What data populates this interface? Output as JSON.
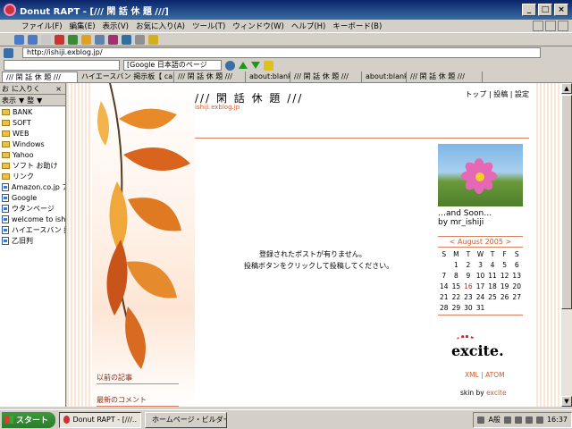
{
  "window": {
    "title": "Donut RAPT - [/// 閑 話 休 題 ///]",
    "minimize": "_",
    "maximize": "□",
    "close": "×"
  },
  "menu": [
    "ファイル(F)",
    "編集(E)",
    "表示(V)",
    "お気に入り(A)",
    "ツール(T)",
    "ウィンドウ(W)",
    "ヘルプ(H)",
    "キーボード(B)"
  ],
  "address": {
    "url": "http://ishiji.exblog.jp/"
  },
  "search": {
    "engine": "[Google 日本語のページ"
  },
  "tabs": [
    {
      "label": "/// 閑 話 休 題 ///",
      "active": true
    },
    {
      "label": "ハイエースバン 掲示板【 ca..",
      "active": false
    },
    {
      "label": "/// 閑 話 休 題 ///",
      "active": false
    },
    {
      "label": "about:blank",
      "active": false
    },
    {
      "label": "/// 閑 話 休 題 ///",
      "active": false
    },
    {
      "label": "about:blank",
      "active": false
    },
    {
      "label": "/// 閑 話 休 題 ///",
      "active": false
    }
  ],
  "sidebar": {
    "tabs": [
      "お",
      "に入りく",
      "×"
    ],
    "tools": [
      "表示",
      "▼",
      "整",
      "▼"
    ],
    "items": [
      {
        "label": "BANK",
        "type": "folder"
      },
      {
        "label": "SOFT",
        "type": "folder"
      },
      {
        "label": "WEB",
        "type": "folder"
      },
      {
        "label": "Windows",
        "type": "folder"
      },
      {
        "label": "Yahoo",
        "type": "folder"
      },
      {
        "label": "ソフト お助け",
        "type": "folder"
      },
      {
        "label": "リンク",
        "type": "folder"
      },
      {
        "label": "Amazon.co.jp ア",
        "type": "page"
      },
      {
        "label": "Google",
        "type": "page"
      },
      {
        "label": "ウタンページ",
        "type": "page"
      },
      {
        "label": "welcome to ish",
        "type": "page"
      },
      {
        "label": "ハイエースバン 掲",
        "type": "page"
      },
      {
        "label": "乙旧判",
        "type": "page"
      }
    ]
  },
  "blog": {
    "title": "/// 閑 話 休 題 ///",
    "url": "ishiji.exblog.jp",
    "nav": "トップ | 投稿 | 設定",
    "notice_line1": "登録されたポストが有りません。",
    "notice_line2": "投稿ボタンをクリックして投稿してください。",
    "profile_caption": "…and Soon…",
    "profile_by": "by mr_ishiji",
    "calendar": {
      "title": "< August 2005 >",
      "weekdays": [
        "S",
        "M",
        "T",
        "W",
        "T",
        "F",
        "S"
      ],
      "weeks": [
        [
          "",
          "1",
          "2",
          "3",
          "4",
          "5",
          "6"
        ],
        [
          "7",
          "8",
          "9",
          "10",
          "11",
          "12",
          "13"
        ],
        [
          "14",
          "15",
          "16",
          "17",
          "18",
          "19",
          "20"
        ],
        [
          "21",
          "22",
          "23",
          "24",
          "25",
          "26",
          "27"
        ],
        [
          "28",
          "29",
          "30",
          "31",
          "",
          "",
          ""
        ]
      ],
      "highlight": "16"
    },
    "side_heading1": "以前の記事",
    "side_heading2": "最新のコメント",
    "brand": "excite.",
    "footer_links": "XML | ATOM",
    "skin_by_prefix": "skin by ",
    "skin_by_name": "excite"
  },
  "taskbar": {
    "start": "スタート",
    "tasks": [
      {
        "label": "Donut RAPT - [///..",
        "active": true
      },
      {
        "label": "ホームページ・ビルダー..",
        "active": false
      }
    ],
    "clock": "16:37",
    "ime": "A般"
  },
  "colors": {
    "accent": "#d25a2c",
    "titlebar": "#0a246a",
    "start": "#3c9a3c"
  }
}
